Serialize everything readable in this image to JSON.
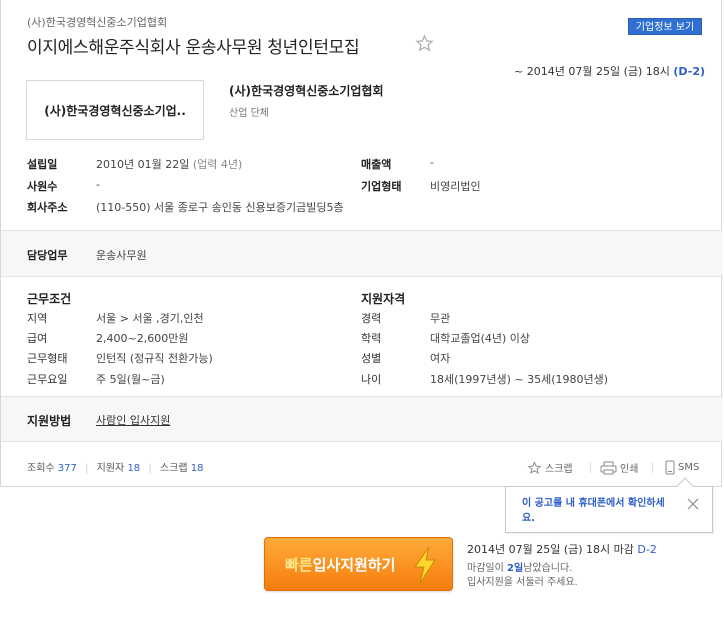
{
  "header": {
    "company_top": "(사)한국경영혁신중소기업협회",
    "info_button": "기업정보 보기",
    "job_title": "이지에스해운주식회사 운송사무원 청년인턴모집",
    "deadline": "~ 2014년 07월 25일 (금) 18시",
    "dday": "(D-2)"
  },
  "company": {
    "logo_text": "(사)한국경영혁신중소기업..",
    "name": "(사)한국경영혁신중소기업협회",
    "type": "산업 단체"
  },
  "details": {
    "founded_label": "설립일",
    "founded_value": "2010년 01월 22일",
    "founded_sub": "(업력 4년)",
    "employees_label": "사원수",
    "employees_value": "-",
    "address_label": "회사주소",
    "address_value": "(110-550) 서울 종로구 송인동 신용보증기금빌딩5층",
    "sales_label": "매출액",
    "sales_value": "-",
    "form_label": "기업형태",
    "form_value": "비영리법인"
  },
  "duty": {
    "label": "담당업무",
    "value": "운송사무원"
  },
  "conditions": {
    "title": "근무조건",
    "rows": [
      {
        "label": "지역",
        "value": "서울 > 서울 ,경기,인천"
      },
      {
        "label": "급여",
        "value": "2,400~2,600만원"
      },
      {
        "label": "근무형태",
        "value": "인턴직 (정규직 전환가능)"
      },
      {
        "label": "근무요일",
        "value": "주 5일(월~금)"
      }
    ]
  },
  "qualifications": {
    "title": "지원자격",
    "rows": [
      {
        "label": "경력",
        "value": "무관"
      },
      {
        "label": "학력",
        "value": "대학교졸업(4년) 이상"
      },
      {
        "label": "성별",
        "value": "여자"
      },
      {
        "label": "나이",
        "value": "18세(1997년생) ~ 35세(1980년생)"
      }
    ]
  },
  "apply_method": {
    "label": "지원방법",
    "value": "사람인 입사지원"
  },
  "stats": {
    "views_label": "조회수",
    "views": "377",
    "applicants_label": "지원자",
    "applicants": "18",
    "scraps_label": "스크랩",
    "scraps": "18"
  },
  "tools": {
    "scrap": "스크랩",
    "print": "인쇄",
    "sms": "SMS"
  },
  "tooltip": {
    "text": "이 공고를 내 휴대폰에서 확인하세요."
  },
  "apply_button": {
    "highlight": "빠른",
    "label": "입사지원하기"
  },
  "bottom": {
    "deadline": "2014년 07월 25일 (금) 18시 마감",
    "dday": "D-2",
    "remain_pre": "마감일이",
    "remain_num": "2일",
    "remain_post": "남았습니다.",
    "hurry": "입사지원을 서둘러 주세요."
  },
  "colors": {
    "accent_blue": "#2e5fc9",
    "button_orange": "#f57d0d"
  }
}
